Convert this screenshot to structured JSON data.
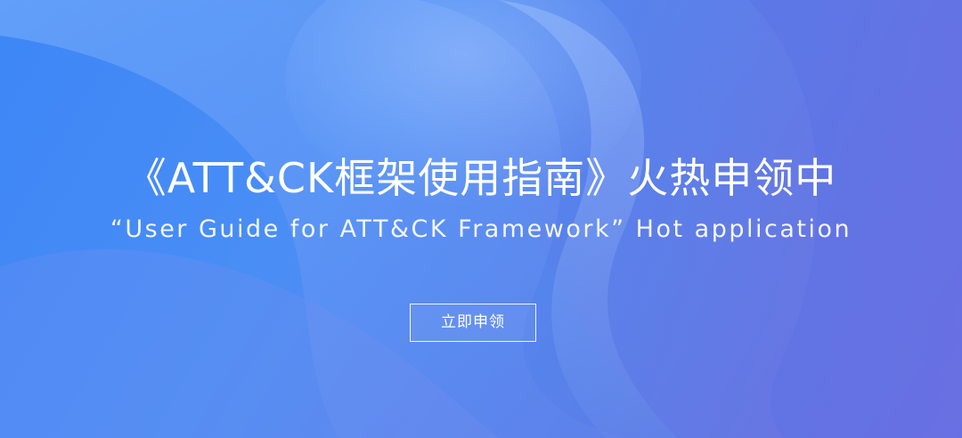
{
  "banner": {
    "headline": "《ATT&CK框架使用指南》火热申领中",
    "subline": "“User Guide for ATT&CK Framework” Hot application",
    "cta_label": "立即申领"
  },
  "colors": {
    "background_start": "#3d86f7",
    "background_end": "#6a6fe0",
    "text": "#ffffff"
  }
}
